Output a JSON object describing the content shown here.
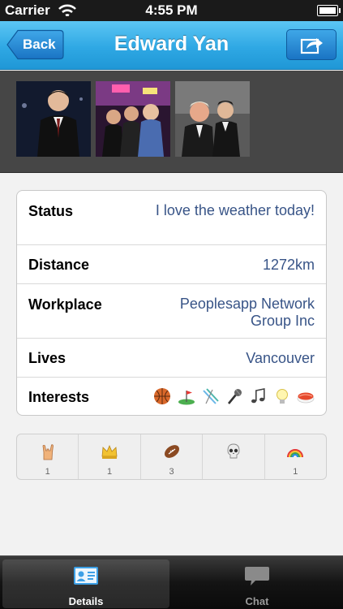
{
  "status_bar": {
    "carrier": "Carrier",
    "time": "4:55 PM",
    "icons": [
      "wifi-icon",
      "battery-icon"
    ]
  },
  "nav": {
    "back_label": "Back",
    "title": "Edward Yan",
    "share_icon": "share-icon"
  },
  "photos": [
    {
      "name": "profile-photo-1"
    },
    {
      "name": "profile-photo-2"
    },
    {
      "name": "profile-photo-3"
    }
  ],
  "details": {
    "status_label": "Status",
    "status_value": "I love the weather today!",
    "distance_label": "Distance",
    "distance_value": "1272km",
    "workplace_label": "Workplace",
    "workplace_value": "Peoplesapp Network Group Inc",
    "lives_label": "Lives",
    "lives_value": "Vancouver",
    "interests_label": "Interests",
    "interests_icons": [
      "basketball-icon",
      "golf-icon",
      "ski-icon",
      "microphone-icon",
      "music-notes-icon",
      "lightbulb-icon",
      "sushi-icon"
    ]
  },
  "reactions": [
    {
      "icon": "rock-hand-icon",
      "count": "1"
    },
    {
      "icon": "crown-icon",
      "count": "1"
    },
    {
      "icon": "football-icon",
      "count": "3"
    },
    {
      "icon": "skull-icon",
      "count": ""
    },
    {
      "icon": "rainbow-icon",
      "count": "1"
    }
  ],
  "tab_bar": {
    "details_label": "Details",
    "chat_label": "Chat"
  },
  "colors": {
    "nav_blue": "#2fa8e4",
    "value_blue": "#385487",
    "tab_dark": "#141414"
  }
}
